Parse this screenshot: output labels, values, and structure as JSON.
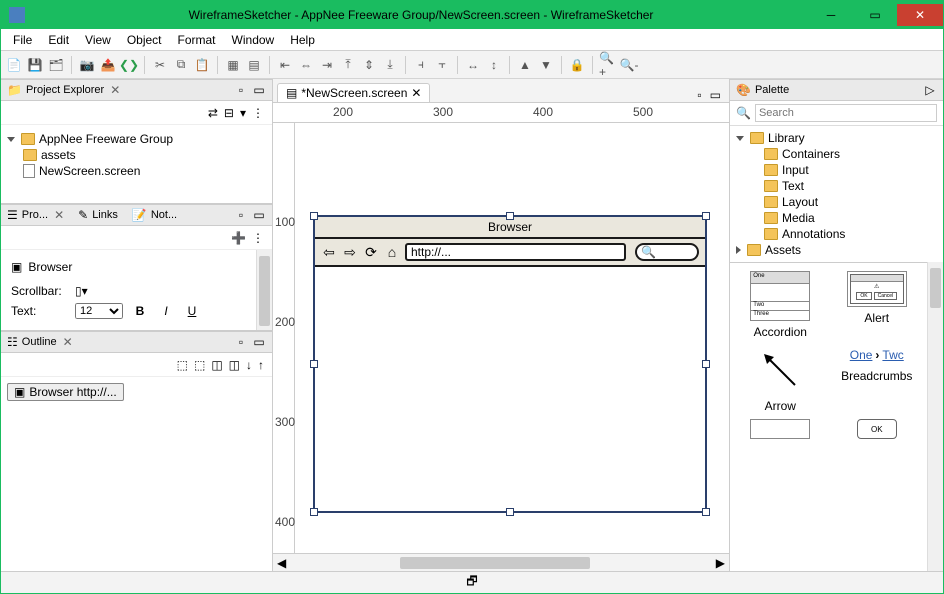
{
  "window": {
    "title": "WireframeSketcher - AppNee Freeware Group/NewScreen.screen - WireframeSketcher"
  },
  "menu": [
    "File",
    "Edit",
    "View",
    "Object",
    "Format",
    "Window",
    "Help"
  ],
  "projectExplorer": {
    "title": "Project Explorer",
    "root": "AppNee Freeware Group",
    "items": [
      "assets",
      "NewScreen.screen"
    ]
  },
  "propsTabs": {
    "tab1": "Pro...",
    "tab2": "Links",
    "tab3": "Not..."
  },
  "properties": {
    "heading": "Browser",
    "scrollbar_label": "Scrollbar:",
    "text_label": "Text:",
    "font_size": "12"
  },
  "outline": {
    "title": "Outline",
    "item": "Browser http://..."
  },
  "editor": {
    "tab": "*NewScreen.screen",
    "ruler_h": [
      "200",
      "300",
      "400",
      "500"
    ],
    "ruler_v": [
      "100",
      "200",
      "300",
      "400"
    ],
    "browser_title": "Browser",
    "url": "http://..."
  },
  "palette": {
    "title": "Palette",
    "search_placeholder": "Search",
    "library": "Library",
    "assets": "Assets",
    "cats": [
      "Containers",
      "Input",
      "Text",
      "Layout",
      "Media",
      "Annotations"
    ],
    "items": [
      "Accordion",
      "Alert",
      "Arrow",
      "Breadcrumbs"
    ],
    "breadcrumb_one": "One",
    "breadcrumb_two": "Twc",
    "alert_ok": "OK"
  }
}
